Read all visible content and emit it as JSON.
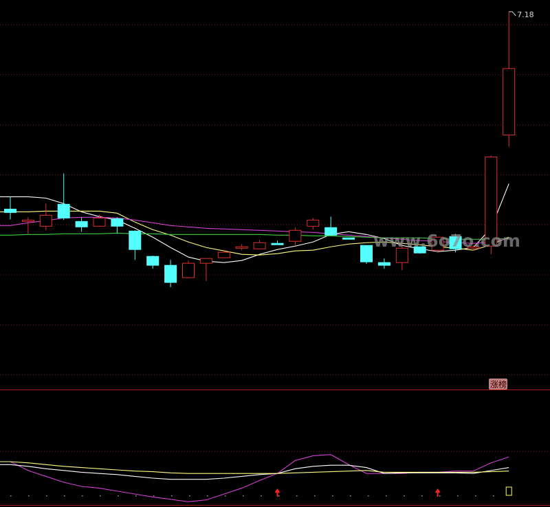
{
  "colors": {
    "background": "#000000",
    "grid": "#7a1a1a",
    "separator": "#b02020",
    "up_candle": "#e03030",
    "down_candle": "#54ffff",
    "ma_white": "#ffffff",
    "ma_yellow": "#ffff80",
    "ma_magenta": "#d040d0",
    "ma_green": "#40d040",
    "badge_bg": "#c08080",
    "badge_text": "#400000",
    "signal_arrow": "#ff2020",
    "marker_box": "#ffff60",
    "watermark": "#8a8a8a"
  },
  "labels": {
    "high_price": "7.18",
    "badge": "涨榜",
    "watermark": "www.6o7o.com"
  },
  "icons": {
    "signal": "up-arrow-icon",
    "cursor_marker": "outline-box-icon"
  },
  "chart_data": [
    {
      "type": "candlestick",
      "title": "",
      "xlabel": "",
      "ylabel": "",
      "ylim": [
        2.68,
        7.3
      ],
      "annotations": [
        {
          "text": "7.18",
          "at": "highest high"
        }
      ],
      "candles": [
        {
          "o": 4.3,
          "h": 4.48,
          "l": 4.15,
          "c": 4.25
        },
        {
          "o": 4.12,
          "h": 4.18,
          "l": 3.94,
          "c": 4.14
        },
        {
          "o": 4.05,
          "h": 4.38,
          "l": 3.99,
          "c": 4.21
        },
        {
          "o": 4.37,
          "h": 4.82,
          "l": 4.14,
          "c": 4.17
        },
        {
          "o": 4.12,
          "h": 4.18,
          "l": 3.97,
          "c": 4.04
        },
        {
          "o": 4.05,
          "h": 4.22,
          "l": 4.04,
          "c": 4.17
        },
        {
          "o": 4.16,
          "h": 4.18,
          "l": 3.94,
          "c": 4.05
        },
        {
          "o": 3.98,
          "h": 3.99,
          "l": 3.56,
          "c": 3.71
        },
        {
          "o": 3.61,
          "h": 3.62,
          "l": 3.43,
          "c": 3.48
        },
        {
          "o": 3.48,
          "h": 3.56,
          "l": 3.16,
          "c": 3.23
        },
        {
          "o": 3.3,
          "h": 3.55,
          "l": 3.29,
          "c": 3.51
        },
        {
          "o": 3.51,
          "h": 3.57,
          "l": 3.25,
          "c": 3.58
        },
        {
          "o": 3.59,
          "h": 3.71,
          "l": 3.58,
          "c": 3.67
        },
        {
          "o": 3.74,
          "h": 3.79,
          "l": 3.7,
          "c": 3.75
        },
        {
          "o": 3.72,
          "h": 3.85,
          "l": 3.72,
          "c": 3.81
        },
        {
          "o": 3.8,
          "h": 3.84,
          "l": 3.78,
          "c": 3.79
        },
        {
          "o": 3.83,
          "h": 4.03,
          "l": 3.77,
          "c": 3.99
        },
        {
          "o": 4.05,
          "h": 4.17,
          "l": 4.0,
          "c": 4.14
        },
        {
          "o": 4.03,
          "h": 4.19,
          "l": 3.91,
          "c": 3.92
        },
        {
          "o": 3.88,
          "h": 3.88,
          "l": 3.86,
          "c": 3.87
        },
        {
          "o": 3.77,
          "h": 3.77,
          "l": 3.5,
          "c": 3.53
        },
        {
          "o": 3.52,
          "h": 3.58,
          "l": 3.43,
          "c": 3.48
        },
        {
          "o": 3.52,
          "h": 3.77,
          "l": 3.41,
          "c": 3.73
        },
        {
          "o": 3.75,
          "h": 3.75,
          "l": 3.65,
          "c": 3.66
        },
        {
          "o": 3.7,
          "h": 3.89,
          "l": 3.66,
          "c": 3.89
        },
        {
          "o": 3.9,
          "h": 3.94,
          "l": 3.67,
          "c": 3.72
        },
        {
          "o": 3.73,
          "h": 3.77,
          "l": 3.69,
          "c": 3.75
        },
        {
          "o": 3.76,
          "h": 5.08,
          "l": 3.64,
          "c": 5.06
        },
        {
          "o": 5.38,
          "h": 7.18,
          "l": 5.21,
          "c": 6.35
        }
      ],
      "ma_series": [
        {
          "color": "#ffffff",
          "values": [
            4.48,
            4.48,
            4.46,
            4.38,
            4.26,
            4.19,
            4.14,
            4.02,
            3.89,
            3.74,
            3.6,
            3.54,
            3.52,
            3.55,
            3.64,
            3.71,
            3.76,
            3.82,
            3.93,
            3.97,
            3.93,
            3.87,
            3.77,
            3.72,
            3.68,
            3.7,
            3.74,
            4.02,
            4.67
          ]
        },
        {
          "color": "#ffff80",
          "values": [
            4.26,
            4.26,
            4.27,
            4.27,
            4.27,
            4.27,
            4.24,
            4.11,
            4.0,
            3.92,
            3.82,
            3.74,
            3.69,
            3.64,
            3.63,
            3.65,
            3.69,
            3.7,
            3.75,
            3.79,
            3.81,
            3.82,
            3.8,
            3.78,
            3.75,
            3.73,
            3.7,
            3.78,
            3.89
          ]
        },
        {
          "color": "#d040d0",
          "values": [
            4.06,
            4.1,
            4.13,
            4.17,
            4.18,
            4.18,
            4.17,
            4.14,
            4.1,
            4.06,
            4.04,
            4.02,
            4.01,
            4.0,
            3.99,
            3.98,
            3.97,
            3.96,
            3.94,
            3.92,
            3.9,
            3.88,
            3.86,
            3.84,
            3.83,
            3.81,
            3.8,
            3.82,
            3.87
          ]
        },
        {
          "color": "#40d040",
          "values": [
            3.92,
            3.93,
            3.93,
            3.94,
            3.94,
            3.94,
            3.95,
            3.94,
            3.94,
            3.93,
            3.93,
            3.93,
            3.93,
            3.93,
            3.93,
            3.92,
            3.92,
            3.91,
            3.91,
            3.9,
            3.89,
            3.88,
            3.88,
            3.88,
            3.87,
            3.86,
            3.86,
            3.86,
            3.87
          ]
        }
      ]
    },
    {
      "type": "line",
      "title": "",
      "xlabel": "",
      "ylabel": "",
      "x": [
        0,
        1,
        2,
        3,
        4,
        5,
        6,
        7,
        8,
        9,
        10,
        11,
        12,
        13,
        14,
        15,
        16,
        17,
        18,
        19,
        20,
        21,
        22,
        23,
        24,
        25,
        26,
        27,
        28
      ],
      "ylim": [
        -20,
        120
      ],
      "series": [
        {
          "color": "#d040d0",
          "values": [
            50,
            35,
            25,
            15,
            8,
            5,
            0,
            -5,
            -10,
            -14,
            -18,
            -15,
            -5,
            5,
            18,
            30,
            52,
            60,
            62,
            45,
            30,
            30,
            30,
            32,
            32,
            34,
            34,
            48,
            58
          ]
        },
        {
          "color": "#ffffff",
          "values": [
            45,
            42,
            38,
            35,
            32,
            30,
            28,
            25,
            22,
            20,
            20,
            20,
            22,
            25,
            28,
            30,
            38,
            42,
            44,
            44,
            40,
            30,
            31,
            31,
            31,
            31,
            30,
            35,
            40
          ]
        },
        {
          "color": "#ffff80",
          "values": [
            50,
            48,
            45,
            42,
            40,
            38,
            36,
            34,
            33,
            31,
            30,
            30,
            30,
            30,
            30,
            30,
            31,
            32,
            33,
            34,
            35,
            32,
            32,
            32,
            32,
            32,
            32,
            33,
            34
          ]
        }
      ],
      "signals": [
        {
          "type": "up-arrow",
          "index": 15
        },
        {
          "type": "up-arrow",
          "index": 24
        }
      ]
    }
  ]
}
